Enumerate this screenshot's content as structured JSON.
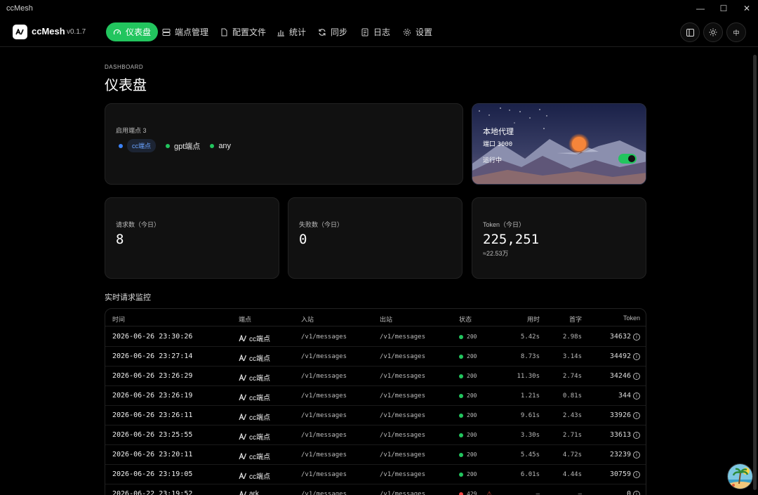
{
  "window": {
    "title": "ccMesh",
    "controls": [
      "—",
      "☐",
      "✕"
    ]
  },
  "app": {
    "name": "ccMesh",
    "version": "v0.1.7"
  },
  "nav": [
    {
      "label": "仪表盘",
      "icon": "gauge-icon",
      "active": true
    },
    {
      "label": "端点管理",
      "icon": "server-icon"
    },
    {
      "label": "配置文件",
      "icon": "file-icon"
    },
    {
      "label": "统计",
      "icon": "bar-chart-icon"
    },
    {
      "label": "同步",
      "icon": "sync-icon"
    },
    {
      "label": "日志",
      "icon": "log-icon"
    },
    {
      "label": "设置",
      "icon": "gear-icon"
    }
  ],
  "header_buttons": {
    "lang_label": "中"
  },
  "page": {
    "eyebrow": "DASHBOARD",
    "title": "仪表盘"
  },
  "endpoints_card": {
    "label": "启用端点 3",
    "endpoints": [
      {
        "name": "cc端点",
        "color": "#3b82f6",
        "selected": true
      },
      {
        "name": "gpt端点",
        "color": "#22c55e"
      },
      {
        "name": "any",
        "color": "#22c55e"
      }
    ]
  },
  "proxy_card": {
    "title": "本地代理",
    "port_label": "端口",
    "port": "3000",
    "status": "运行中",
    "enabled": true
  },
  "stats": {
    "requests": {
      "label": "请求数（今日）",
      "value": "8"
    },
    "failures": {
      "label": "失败数（今日）",
      "value": "0"
    },
    "tokens": {
      "label": "Token（今日）",
      "value": "225,251",
      "sub": "≈22.53万"
    }
  },
  "monitor": {
    "title": "实时请求监控",
    "columns": [
      "时间",
      "端点",
      "入站",
      "出站",
      "状态",
      "用时",
      "首字",
      "Token"
    ],
    "rows": [
      {
        "time": "2026-06-26 23:30:26",
        "endpoint": "cc端点",
        "inbound": "/v1/messages",
        "outbound": "/v1/messages",
        "status": "200",
        "status_color": "#22c55e",
        "used": "5.42s",
        "first": "2.98s",
        "token": "34632"
      },
      {
        "time": "2026-06-26 23:27:14",
        "endpoint": "cc端点",
        "inbound": "/v1/messages",
        "outbound": "/v1/messages",
        "status": "200",
        "status_color": "#22c55e",
        "used": "8.73s",
        "first": "3.14s",
        "token": "34492"
      },
      {
        "time": "2026-06-26 23:26:29",
        "endpoint": "cc端点",
        "inbound": "/v1/messages",
        "outbound": "/v1/messages",
        "status": "200",
        "status_color": "#22c55e",
        "used": "11.30s",
        "first": "2.74s",
        "token": "34246"
      },
      {
        "time": "2026-06-26 23:26:19",
        "endpoint": "cc端点",
        "inbound": "/v1/messages",
        "outbound": "/v1/messages",
        "status": "200",
        "status_color": "#22c55e",
        "used": "1.21s",
        "first": "0.81s",
        "token": "344"
      },
      {
        "time": "2026-06-26 23:26:11",
        "endpoint": "cc端点",
        "inbound": "/v1/messages",
        "outbound": "/v1/messages",
        "status": "200",
        "status_color": "#22c55e",
        "used": "9.61s",
        "first": "2.43s",
        "token": "33926"
      },
      {
        "time": "2026-06-26 23:25:55",
        "endpoint": "cc端点",
        "inbound": "/v1/messages",
        "outbound": "/v1/messages",
        "status": "200",
        "status_color": "#22c55e",
        "used": "3.30s",
        "first": "2.71s",
        "token": "33613"
      },
      {
        "time": "2026-06-26 23:20:11",
        "endpoint": "cc端点",
        "inbound": "/v1/messages",
        "outbound": "/v1/messages",
        "status": "200",
        "status_color": "#22c55e",
        "used": "5.45s",
        "first": "4.72s",
        "token": "23239"
      },
      {
        "time": "2026-06-26 23:19:05",
        "endpoint": "cc端点",
        "inbound": "/v1/messages",
        "outbound": "/v1/messages",
        "status": "200",
        "status_color": "#22c55e",
        "used": "6.01s",
        "first": "4.44s",
        "token": "30759"
      },
      {
        "time": "2026-06-22 23:19:52",
        "endpoint": "ark",
        "inbound": "/v1/messages",
        "outbound": "/v1/messages",
        "status": "429",
        "status_color": "#ef4444",
        "warning": "⚠",
        "used": "–",
        "first": "–",
        "token": "0"
      }
    ]
  }
}
